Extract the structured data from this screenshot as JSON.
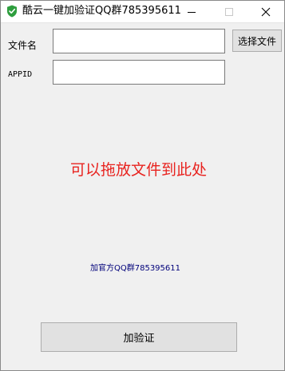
{
  "window": {
    "title": "酷云一键加验证QQ群785395611",
    "icon": "shield-icon",
    "accent_color": "#2e9e3e"
  },
  "form": {
    "file_label": "文件名",
    "file_value": "",
    "select_button_label": "选择文件",
    "appid_label": "APPID",
    "appid_value": ""
  },
  "drop_hint": {
    "text": "可以拖放文件到此处",
    "color": "#e8231f"
  },
  "qq_link": {
    "text": "加官方QQ群785395611",
    "color": "#00007a"
  },
  "actions": {
    "verify_button_label": "加验证"
  }
}
